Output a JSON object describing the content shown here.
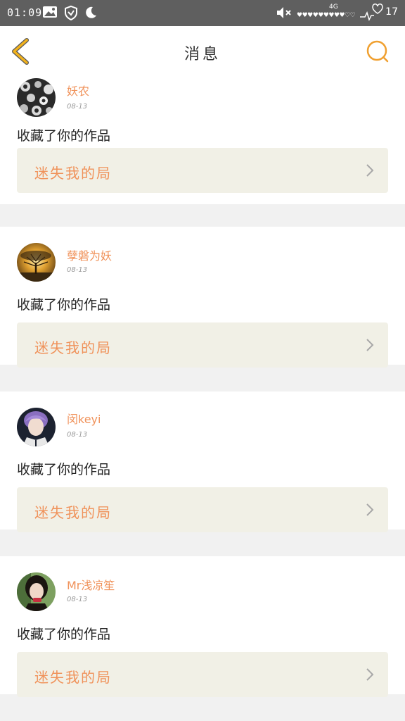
{
  "status_bar": {
    "time": "01:09",
    "network": "4G",
    "hearts": "♥♥♥♥♥♥♥♥♥♡♡",
    "battery": "17",
    "icons": [
      "gallery-icon",
      "shield-icon",
      "moon-icon",
      "mute-icon",
      "heartbeat-icon"
    ]
  },
  "header": {
    "title": "消息",
    "back_icon": "chevron-left-icon",
    "search_icon": "search-icon",
    "accent_color": "#f0a030"
  },
  "messages": [
    {
      "username": "妖农",
      "date": "08-13",
      "action": "收藏了你的作品",
      "work_title": "迷失我的局",
      "avatar": "dark-pattern-avatar"
    },
    {
      "username": "孽磐为妖",
      "date": "08-13",
      "action": "收藏了你的作品",
      "work_title": "迷失我的局",
      "avatar": "sunset-tree-avatar"
    },
    {
      "username": "闵keyi",
      "date": "08-13",
      "action": "收藏了你的作品",
      "work_title": "迷失我的局",
      "avatar": "purple-hair-avatar"
    },
    {
      "username": "Mr浅凉笙",
      "date": "08-13",
      "action": "收藏了你的作品",
      "work_title": "迷失我的局",
      "avatar": "girl-portrait-avatar"
    }
  ],
  "colors": {
    "username": "#f0925a",
    "work_title": "#f0925a",
    "work_background": "#f1f0e6",
    "separator": "#f1f1f1"
  }
}
